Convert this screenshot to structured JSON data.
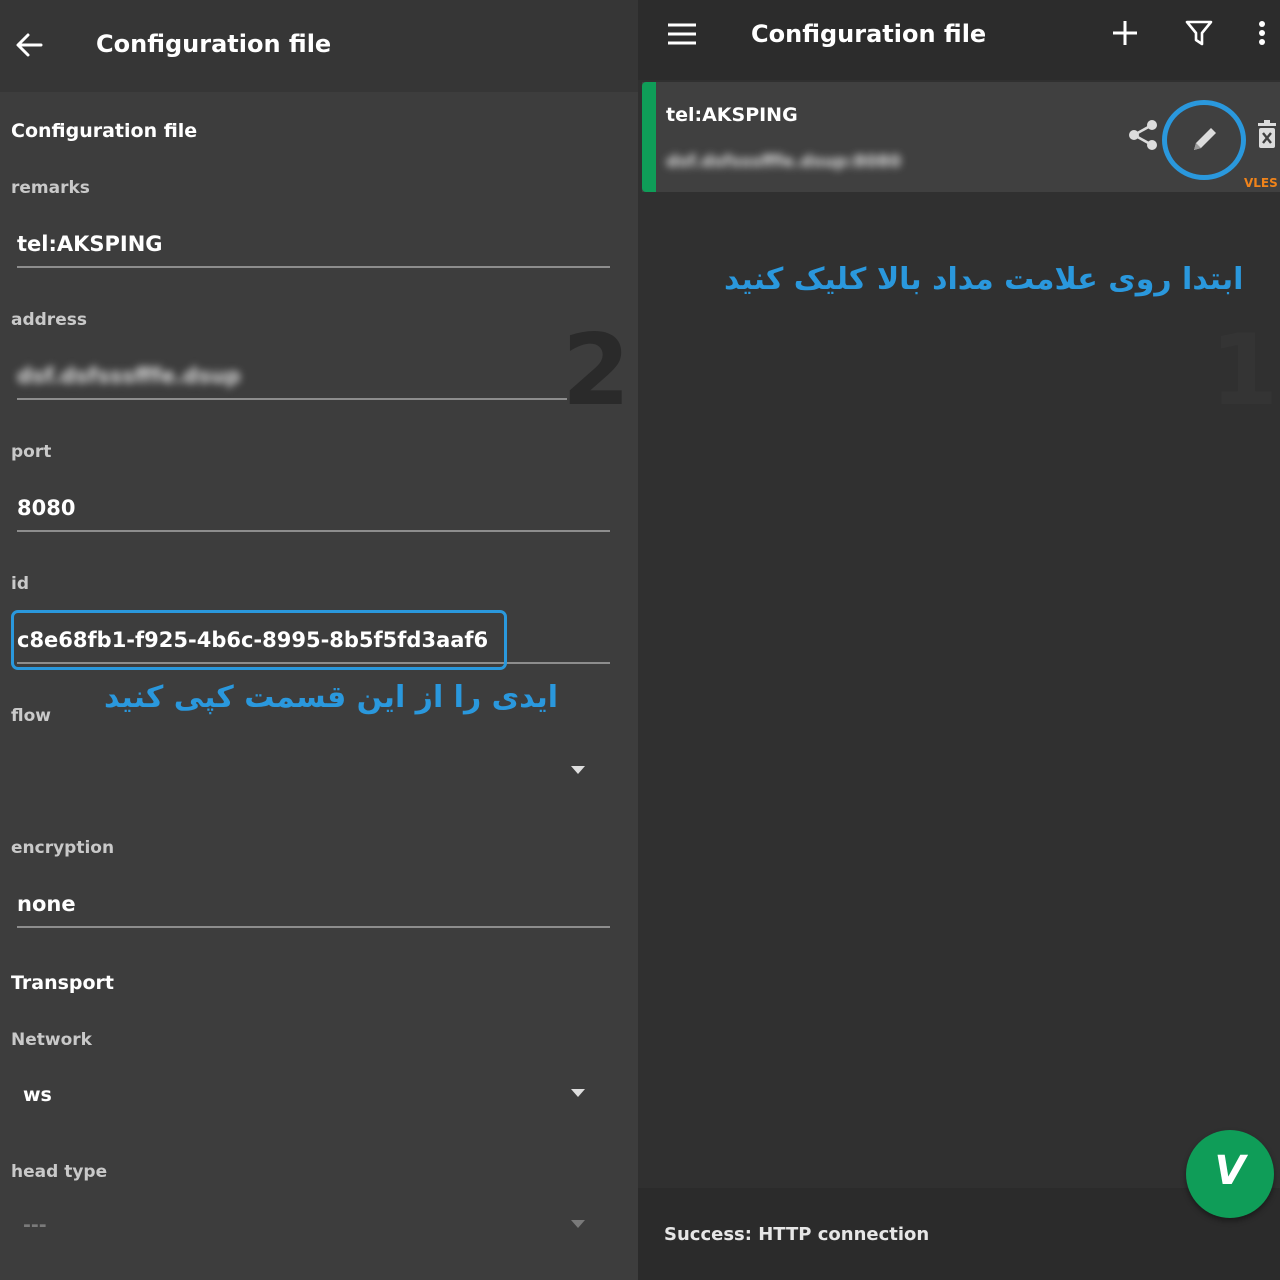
{
  "left": {
    "title": "Configuration file",
    "section_title": "Configuration file",
    "remarks_label": "remarks",
    "remarks_value": "tel:AKSPING",
    "address_label": "address",
    "address_value": "dsf.dsfsssfffe.dsup",
    "port_label": "port",
    "port_value": "8080",
    "id_label": "id",
    "id_value": "c8e68fb1-f925-4b6c-8995-8b5f5fd3aaf6",
    "flow_label": "flow",
    "encryption_label": "encryption",
    "encryption_value": "none",
    "transport_title": "Transport",
    "network_label": "Network",
    "network_value": "ws",
    "headtype_label": "head type",
    "headtype_value": "---",
    "step_number": "2",
    "annotation": "ایدی را از این قسمت کپی کنید"
  },
  "right": {
    "title": "Configuration file",
    "icons": {
      "menu": "menu-icon",
      "add": "plus-icon",
      "filter": "filter-icon",
      "more": "more-vert-icon",
      "share": "share-icon",
      "edit": "pencil-icon",
      "delete": "delete-icon",
      "connect": "v-logo-icon"
    },
    "server_name": "tel:AKSPING",
    "server_address": "dsf.dsfsssfffe.dsup:8080",
    "protocol_tag": "VLES",
    "annotation": "ابتدا روی علامت مداد بالا کلیک کنید",
    "step_number": "1",
    "fab_glyph": "V",
    "status_text": "Success: HTTP connection"
  },
  "colors": {
    "accent_blue": "#2a98dd",
    "green": "#0f9d58",
    "protocol_orange": "#f0831a",
    "panel_bg": "#3d3d3d",
    "dark_bg": "#303030"
  }
}
